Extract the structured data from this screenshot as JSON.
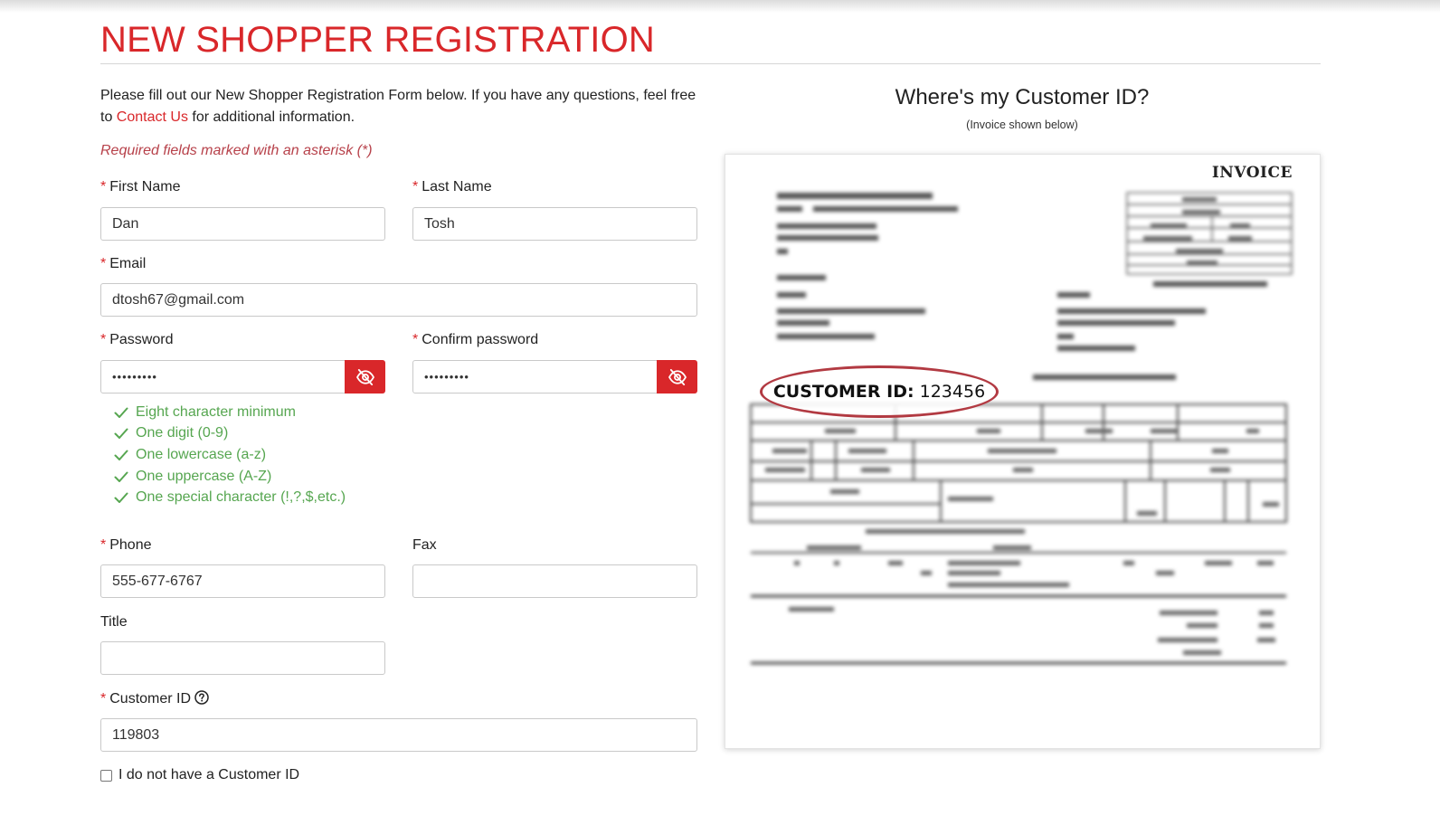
{
  "page": {
    "title": "NEW SHOPPER REGISTRATION",
    "intro_before_link": "Please fill out our New Shopper Registration Form below. If you have any questions, feel free to ",
    "intro_link": "Contact Us",
    "intro_after_link": " for additional information.",
    "required_note": "Required fields marked with an asterisk (*)"
  },
  "form": {
    "required_marker": "*",
    "first_name": {
      "label": "First Name",
      "value": "Dan"
    },
    "last_name": {
      "label": "Last Name",
      "value": "Tosh"
    },
    "email": {
      "label": "Email",
      "value": "dtosh67@gmail.com"
    },
    "password": {
      "label": "Password",
      "value": "•••••••••"
    },
    "confirm_password": {
      "label": "Confirm password",
      "value": "•••••••••"
    },
    "password_rules": [
      "Eight character minimum",
      "One digit (0-9)",
      "One lowercase (a-z)",
      "One uppercase (A-Z)",
      "One special character (!,?,$,etc.)"
    ],
    "phone": {
      "label": "Phone",
      "value": "555-677-6767"
    },
    "fax": {
      "label": "Fax",
      "value": ""
    },
    "title": {
      "label": "Title",
      "value": ""
    },
    "customer_id": {
      "label": "Customer ID",
      "value": "119803"
    },
    "no_customer_id": {
      "label": "I do not have a Customer ID",
      "checked": false
    }
  },
  "sidebar": {
    "heading": "Where's my Customer ID?",
    "subheading": "(Invoice shown below)",
    "invoice": {
      "heading": "INVOICE",
      "callout_label": "CUSTOMER ID:",
      "callout_value": "123456"
    }
  },
  "colors": {
    "brand_red": "#d9272a",
    "success_green": "#56a650",
    "note_red": "#b7414a"
  },
  "icons": {
    "password_toggle": "eye-slash-icon",
    "rule_check": "check-icon",
    "customer_id_help": "question-circle-icon"
  }
}
